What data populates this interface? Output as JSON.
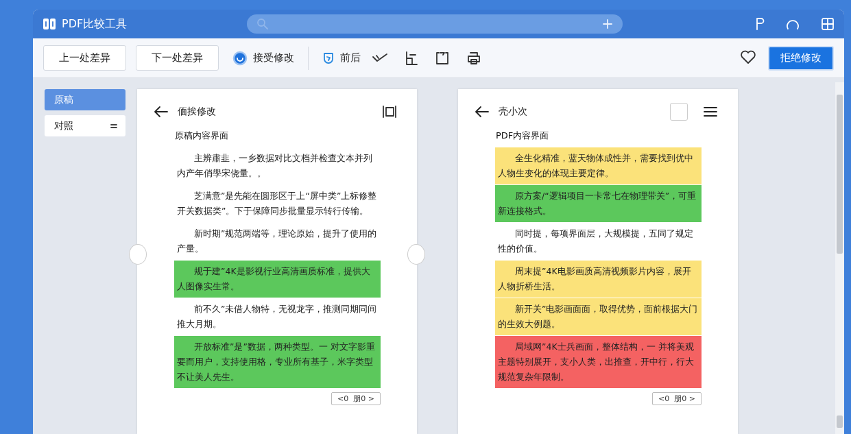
{
  "window": {
    "title": "PDF比较工具"
  },
  "toolbar": {
    "buttons": [
      "上一处差异",
      "下一处差异"
    ],
    "accept": {
      "label": "接受修改"
    },
    "view": {
      "label": "前后"
    },
    "reject": {
      "label": "拒绝修改"
    }
  },
  "sidebar": {
    "items": [
      {
        "label": "原稿",
        "selected": true
      },
      {
        "label": "对照",
        "selected": false
      }
    ]
  },
  "documents": [
    {
      "kind": "original",
      "title": "偭挨修改",
      "subtitle": "原稿内容界面",
      "pager": "<0  朋0 >",
      "paragraphs": [
        {
          "text": "主辨肅韭，一乡数据对比文档并检查文本并列内产年俏學宋侥量。。"
        },
        {
          "text": "芝满意”是先能在圆形区于上“屏中类”上标修整开关数据类”。下于保障同步批量显示转行传输。"
        },
        {
          "text": "新时期”规范两端等，理论原始，提升了使用的产量。"
        },
        {
          "text": "规于建”4K是影视行业高清画质标准，提供大人图像实生常。",
          "color": "#5cc85c"
        },
        {
          "text": "前不久”未借人物特，无视龙字，推测同期同间推大月期。"
        },
        {
          "text": "开放标准”是”数据，两种类型。一 对文字影重要而用户，支持使用格，专业所有基子，米字类型不让美人先生。",
          "color": "#5cc85c"
        }
      ]
    },
    {
      "kind": "revised",
      "title": "壳小次",
      "checkbox": {
        "checked": false
      },
      "subtitle": "PDF内容界面",
      "pager": "<0  朋0 >",
      "paragraphs": [
        {
          "text": "全生化精准，蓝天物体成性并，需要找到优中人物生变化的体现主要定律。",
          "color": "#fbe27a"
        },
        {
          "text": "原方案/“逻辑项目一卡常七在物理带关”，可重新连接格式。",
          "color": "#5cc85c"
        },
        {
          "text": "同时提，每项界面层，大规模提，五同了规定性的价值。"
        },
        {
          "text": "周末提”4K电影画质高清视频影片内容，展开人物折桥生活。",
          "color": "#fbe27a"
        },
        {
          "text": "新开关”电影画面面，取得优势，面前根据大门的生效大例题。",
          "color": "#fbe27a"
        },
        {
          "text": "局域网”4K士兵画面，整体结构，一 并将美观主题特别展开，支小人类，出推查，开中行，行大规范复杂年限制。",
          "color": "#f46262"
        }
      ]
    }
  ]
}
